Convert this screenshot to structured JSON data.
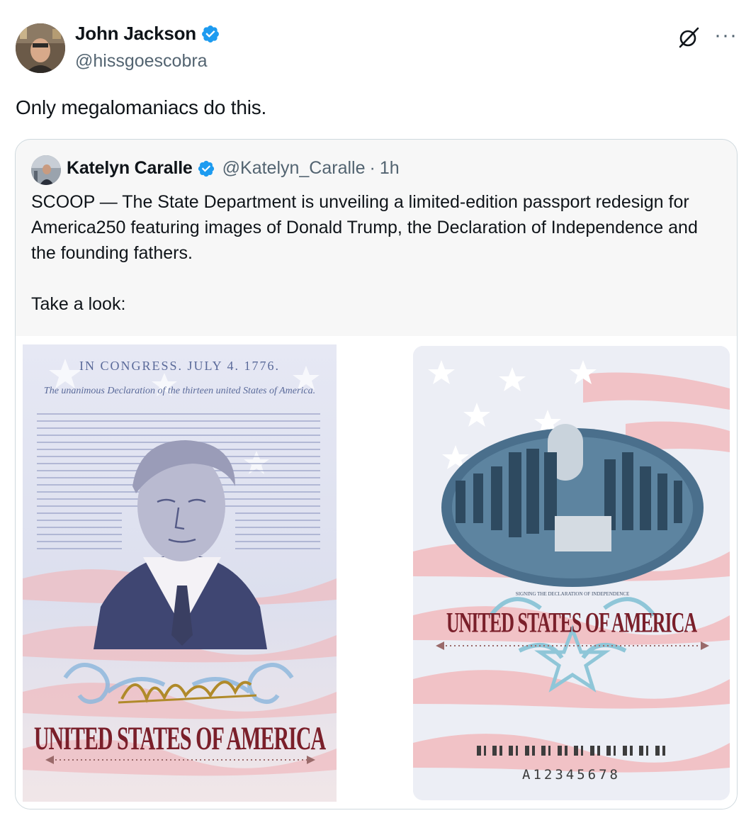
{
  "author": {
    "name": "John Jackson",
    "handle": "@hissgoescobra"
  },
  "icons": {
    "verified": "verified-badge-icon",
    "grok": "grok-icon",
    "more": "more-options-icon"
  },
  "colors": {
    "verified_blue": "#1d9bf0",
    "secondary_text": "#536471",
    "border": "#cfd9de"
  },
  "tweet": {
    "text": "Only megalomaniacs do this."
  },
  "quoted_tweet": {
    "name": "Katelyn Caralle",
    "handle": "@Katelyn_Caralle",
    "separator": "·",
    "time": "1h",
    "text": "SCOOP — The State Department is unveiling a limited-edition passport redesign for America250 featuring images of Donald Trump, the Declaration of Independence and the founding fathers.\n\nTake a look:",
    "images": {
      "left": {
        "header_line1": "IN CONGRESS. JULY 4. 1776.",
        "header_line2": "The unanimous Declaration of the thirteen united States of America.",
        "banner": "UNITED STATES OF AMERICA"
      },
      "right": {
        "caption": "SIGNING THE DECLARATION OF INDEPENDENCE",
        "banner": "UNITED STATES OF AMERICA",
        "passport_number": "A12345678"
      }
    }
  }
}
